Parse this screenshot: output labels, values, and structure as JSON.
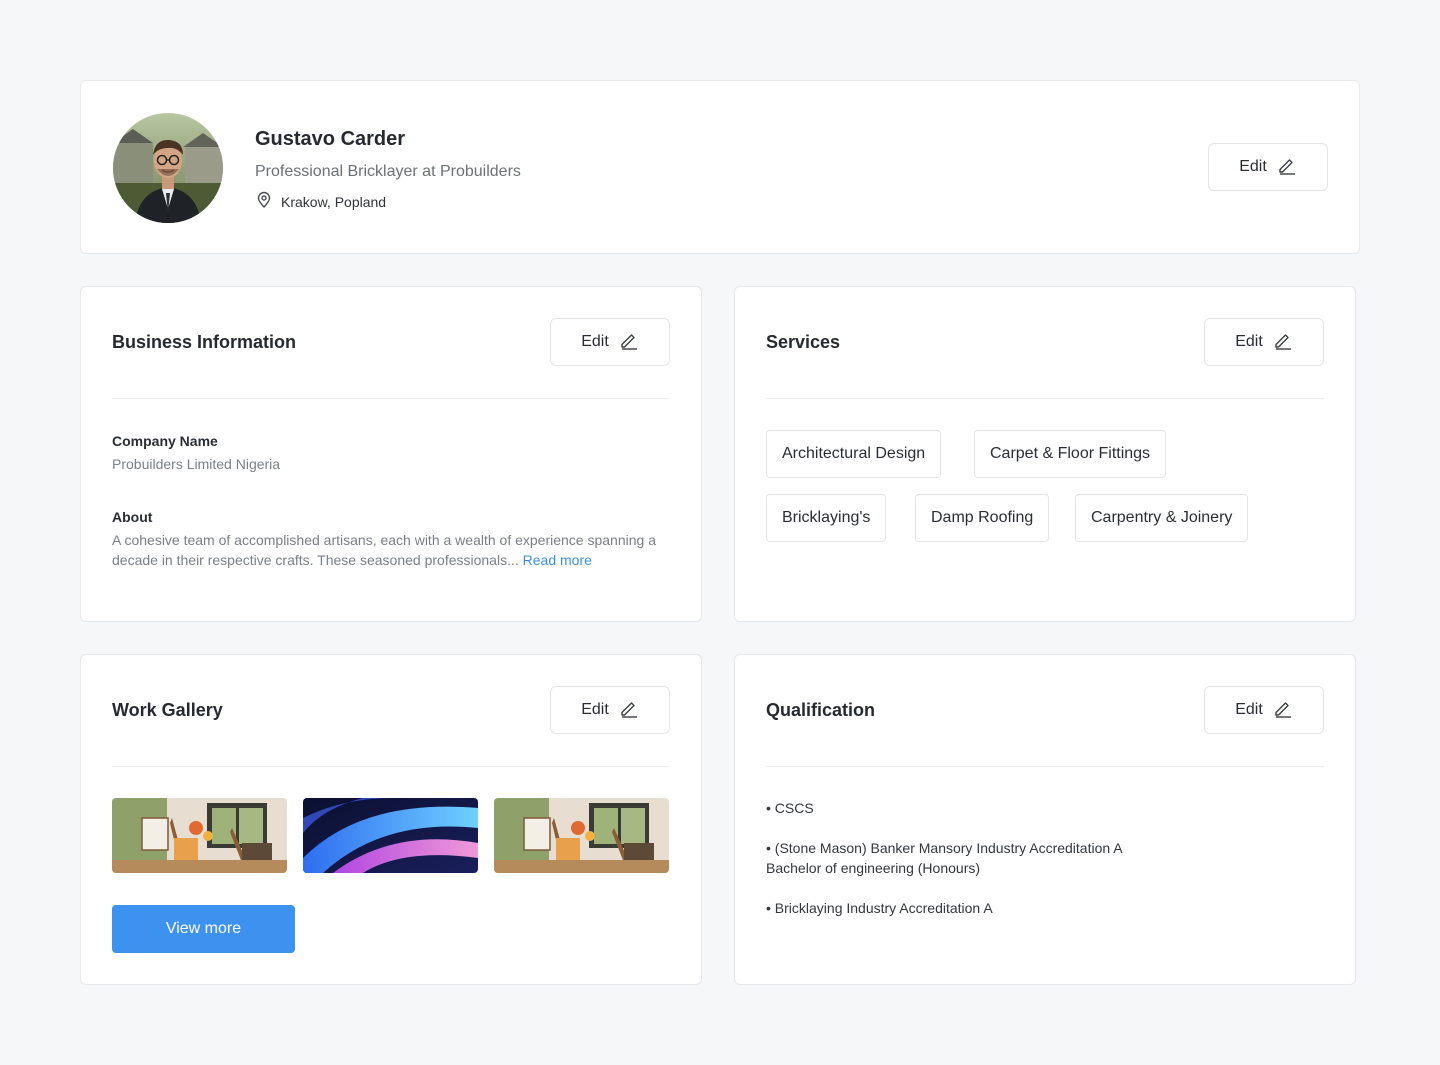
{
  "profile": {
    "name": "Gustavo Carder",
    "title": "Professional Bricklayer at Probuilders",
    "location": "Krakow, Popland",
    "edit_label": "Edit"
  },
  "business": {
    "title": "Business Information",
    "edit_label": "Edit",
    "company_label": "Company Name",
    "company_value": "Probuilders Limited Nigeria",
    "about_label": "About",
    "about_text": "A cohesive team of accomplished artisans, each with a wealth of experience spanning a decade in their respective crafts. These seasoned professionals... ",
    "read_more": "Read more"
  },
  "services": {
    "title": "Services",
    "edit_label": "Edit",
    "items": [
      "Architectural Design",
      "Carpet & Floor Fittings",
      "Bricklaying's",
      "Damp Roofing",
      "Carpentry & Joinery"
    ]
  },
  "gallery": {
    "title": "Work Gallery",
    "edit_label": "Edit",
    "view_more": "View more"
  },
  "qualification": {
    "title": "Qualification",
    "edit_label": "Edit",
    "items": [
      "• CSCS",
      "• (Stone Mason) Banker Mansory Industry Accreditation A Bachelor of engineering (Honours)",
      "• Bricklaying Industry Accreditation A"
    ]
  },
  "colors": {
    "accent": "#3d92f0",
    "link": "#3b8fe6",
    "background": "#f6f7f9"
  },
  "icons": {
    "edit": "pencil-icon",
    "location": "map-pin-icon"
  }
}
